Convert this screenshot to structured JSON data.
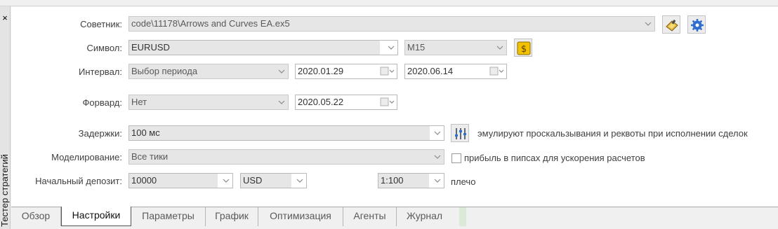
{
  "panel": {
    "title": "Тестер стратегий",
    "close_glyph": "×"
  },
  "form": {
    "advisor": {
      "label": "Советник:",
      "value": "code\\11178\\Arrows and Curves EA.ex5"
    },
    "symbol": {
      "label": "Символ:",
      "value": "EURUSD",
      "timeframe": "M15"
    },
    "interval": {
      "label": "Интервал:",
      "value": "Выбор периода",
      "from": "2020.01.29",
      "to": "2020.06.14"
    },
    "forward": {
      "label": "Форвард:",
      "value": "Нет",
      "date": "2020.05.22"
    },
    "delays": {
      "label": "Задержки:",
      "value": "100 мс",
      "note": "эмулируют проскальзывания и реквоты при исполнении сделок"
    },
    "modeling": {
      "label": "Моделирование:",
      "value": "Все тики",
      "checkbox_label": "прибыль в пипсах для ускорения расчетов",
      "checked": false
    },
    "deposit": {
      "label": "Начальный депозит:",
      "value": "10000",
      "currency": "USD",
      "leverage": "1:100",
      "leverage_label": "плечо"
    }
  },
  "icons": {
    "edit": "edit-ea-icon",
    "settings": "gear-icon",
    "symbol": "symbol-properties-icon",
    "delays": "sliders-icon"
  },
  "tabs": [
    {
      "label": "Обзор",
      "active": false
    },
    {
      "label": "Настройки",
      "active": true
    },
    {
      "label": "Параметры",
      "active": false
    },
    {
      "label": "График",
      "active": false
    },
    {
      "label": "Оптимизация",
      "active": false
    },
    {
      "label": "Агенты",
      "active": false
    },
    {
      "label": "Журнал",
      "active": false
    }
  ],
  "colors": {
    "accent_gear": "#2f6fd0",
    "accent_gold": "#e0b000",
    "active_tab_border": "#555555"
  }
}
